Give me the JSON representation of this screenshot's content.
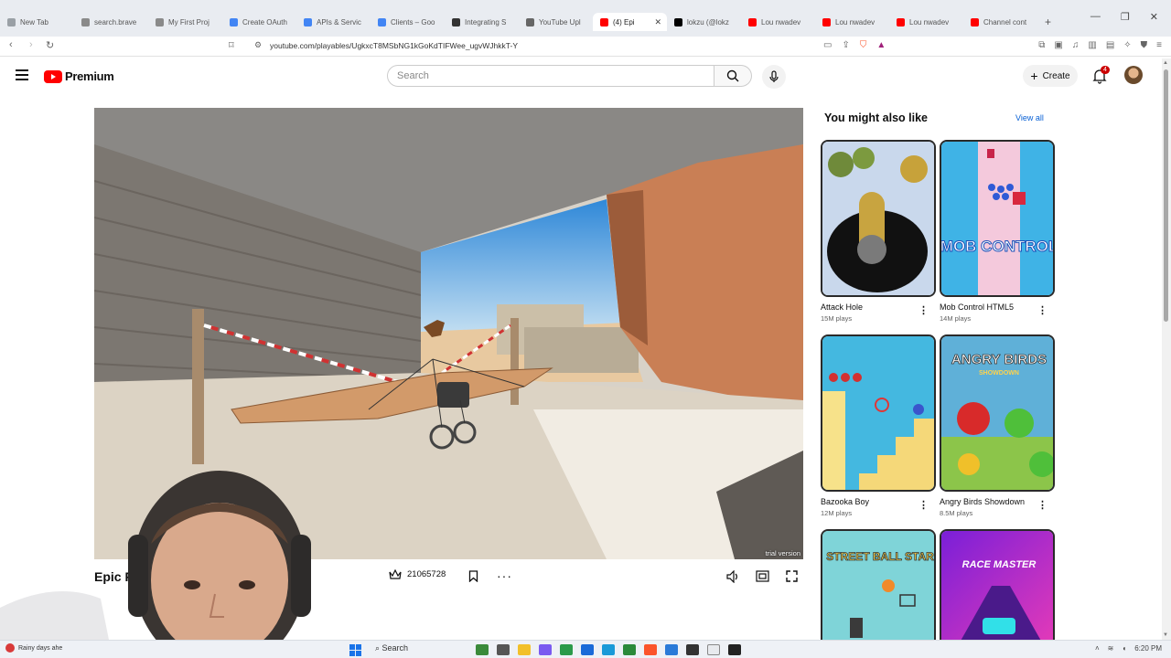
{
  "browser": {
    "tabs": [
      {
        "label": "New Tab",
        "color": "#9aa0a6"
      },
      {
        "label": "search.brave",
        "color": "#8a8a8a"
      },
      {
        "label": "My First Proj",
        "color": "#8a8a8a"
      },
      {
        "label": "Create OAuth",
        "color": "#4285f4"
      },
      {
        "label": "APIs & Servic",
        "color": "#4285f4"
      },
      {
        "label": "Clients – Goo",
        "color": "#4285f4"
      },
      {
        "label": "Integrating S",
        "color": "#333333"
      },
      {
        "label": "YouTube Upl",
        "color": "#666666"
      },
      {
        "label": "(4) Epi",
        "color": "#ff0000",
        "active": true
      },
      {
        "label": "lokzu (@lokz",
        "color": "#000000"
      },
      {
        "label": "Lou nwadev",
        "color": "#ff0000"
      },
      {
        "label": "Lou nwadev",
        "color": "#ff0000"
      },
      {
        "label": "Lou nwadev",
        "color": "#ff0000"
      },
      {
        "label": "Channel cont",
        "color": "#ff0000"
      }
    ],
    "url": "youtube.com/playables/UgkxcT8MSbNG1kGoKdTIFWee_ugvWJhkkT-Y"
  },
  "header": {
    "brand": "Premium",
    "search_placeholder": "Search",
    "create_label": "Create",
    "notification_count": "4"
  },
  "game": {
    "title": "Epic P",
    "plays": "21065728",
    "trial_label": "trial version"
  },
  "sidebar": {
    "title": "You might also like",
    "view_all": "View all",
    "cards": [
      {
        "name": "Attack Hole",
        "plays": "15M plays"
      },
      {
        "name": "Mob Control HTML5",
        "plays": "14M plays"
      },
      {
        "name": "Bazooka Boy",
        "plays": "12M plays"
      },
      {
        "name": "Angry Birds Showdown",
        "plays": "8.5M plays"
      },
      {
        "name": "",
        "plays": ""
      },
      {
        "name": "",
        "plays": ""
      }
    ],
    "thumb_texts": {
      "mob_control": "MOB CONTROL",
      "angry_birds": "ANGRY BIRDS",
      "angry_birds_sub": "SHOWDOWN",
      "street_ball": "STREET BALL STAR",
      "race_master": "RACE MASTER"
    }
  },
  "taskbar": {
    "weather": "Rainy days ahe",
    "search": "Search",
    "time": "6:20 PM"
  },
  "colors": {
    "youtube_red": "#ff0000",
    "link_blue": "#065fd4"
  }
}
